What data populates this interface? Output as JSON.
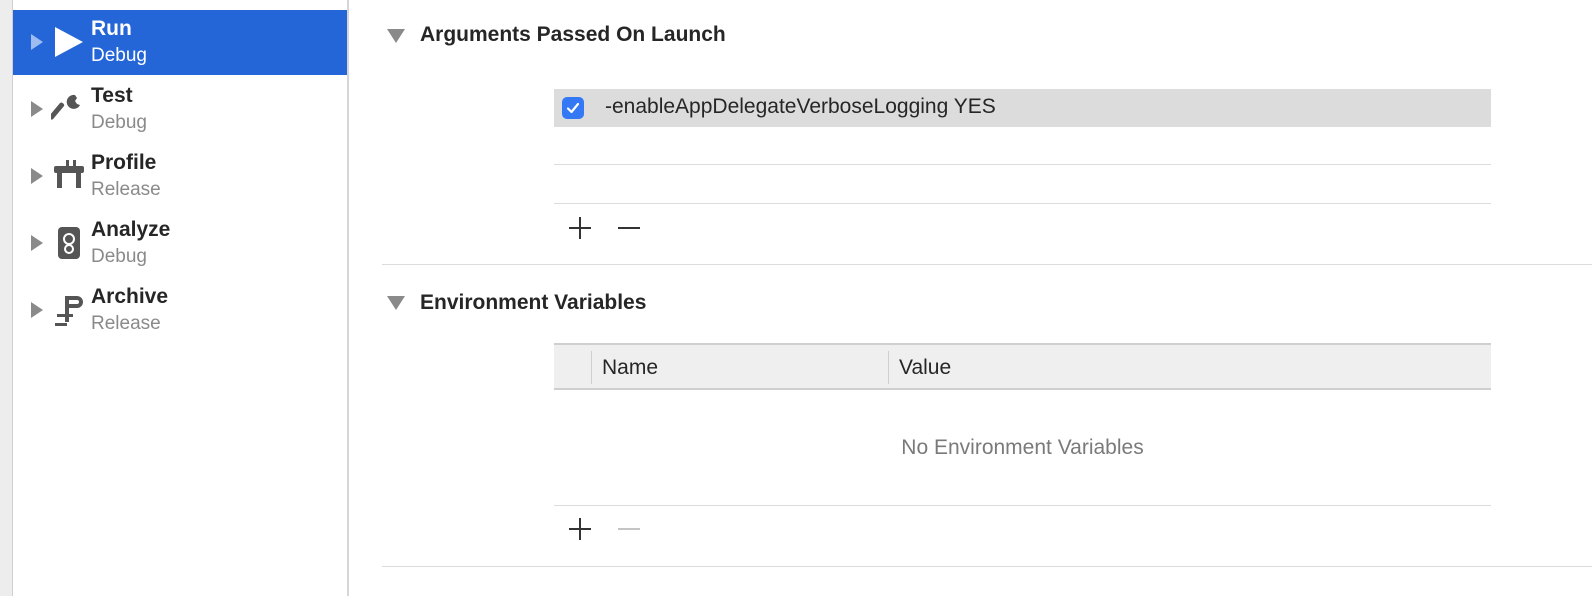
{
  "sidebar": {
    "items": [
      {
        "title": "Run",
        "subtitle": "Debug",
        "icon": "play-icon",
        "selected": true
      },
      {
        "title": "Test",
        "subtitle": "Debug",
        "icon": "wrench-icon",
        "selected": false
      },
      {
        "title": "Profile",
        "subtitle": "Release",
        "icon": "gauge-icon",
        "selected": false
      },
      {
        "title": "Analyze",
        "subtitle": "Debug",
        "icon": "analyze-icon",
        "selected": false
      },
      {
        "title": "Archive",
        "subtitle": "Release",
        "icon": "clamp-icon",
        "selected": false
      }
    ]
  },
  "arguments": {
    "title": "Arguments Passed On Launch",
    "rows": [
      {
        "enabled": true,
        "text": "-enableAppDelegateVerboseLogging YES"
      }
    ]
  },
  "environment": {
    "title": "Environment Variables",
    "columns": [
      "Name",
      "Value"
    ],
    "empty_message": "No Environment Variables"
  },
  "colors": {
    "selection": "#2465d8",
    "checkbox": "#3478f6",
    "row_highlight": "#dcdcdc"
  }
}
